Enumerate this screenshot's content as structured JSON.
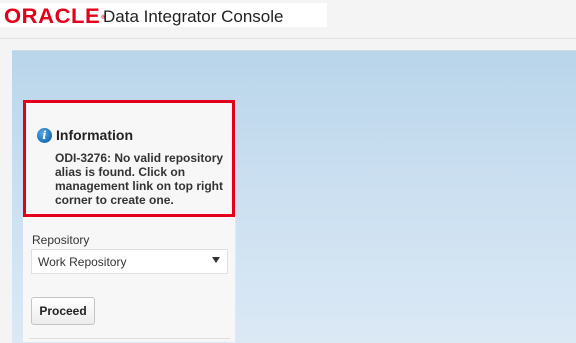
{
  "header": {
    "brand": "ORACLE",
    "brand_mark": "®",
    "app_title": "Data Integrator Console"
  },
  "info": {
    "icon": "info-icon",
    "icon_glyph": "i",
    "title": "Information",
    "message": "ODI-3276: No valid repository alias is found. Click on management link on top right corner to create one."
  },
  "repository": {
    "label": "Repository",
    "selected": "Work Repository"
  },
  "actions": {
    "proceed_label": "Proceed"
  },
  "colors": {
    "brand_red": "#e2001a",
    "info_border": "#e2001a",
    "info_icon_blue": "#1a6fb8",
    "background_blue": "#c9def0"
  }
}
